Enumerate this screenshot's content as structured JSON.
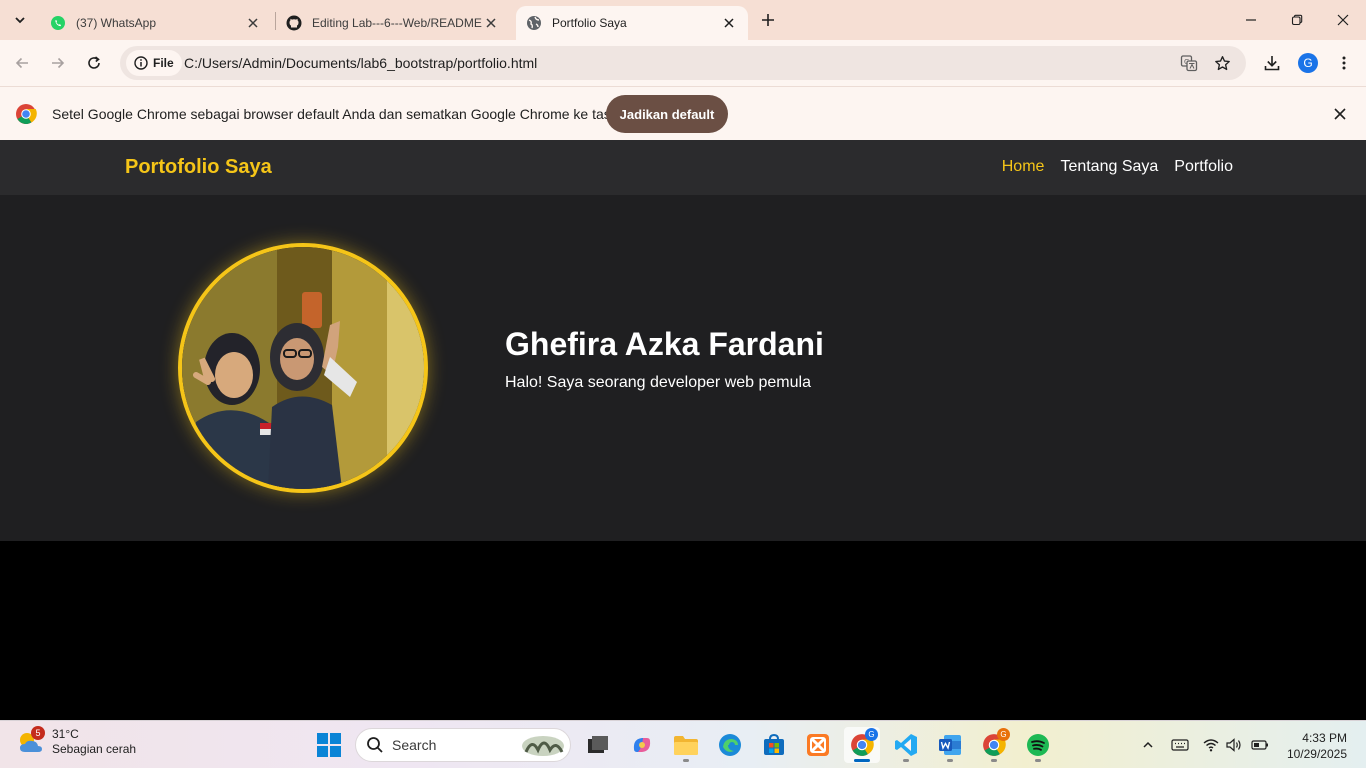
{
  "browser": {
    "tabs": [
      {
        "title": "(37) WhatsApp",
        "icon": "whatsapp-icon"
      },
      {
        "title": "Editing Lab---6---Web/README",
        "icon": "github-icon"
      },
      {
        "title": "Portfolio Saya",
        "icon": "globe-icon",
        "active": true
      }
    ],
    "address": {
      "chip_label": "File",
      "url": "C:/Users/Admin/Documents/lab6_bootstrap/portfolio.html"
    },
    "profile_initial": "G",
    "infobar": {
      "message": "Setel Google Chrome sebagai browser default Anda dan sematkan Google Chrome ke taskbar",
      "button": "Jadikan default"
    }
  },
  "site": {
    "brand": "Portofolio Saya",
    "menu": [
      "Home",
      "Tentang Saya",
      "Portfolio"
    ],
    "hero": {
      "name": "Ghefira Azka Fardani",
      "tagline": "Halo! Saya seorang developer web pemula"
    },
    "colors": {
      "accent": "#f5c518",
      "nav_bg": "#2b2b2d",
      "hero_bg": "#1f1f21"
    }
  },
  "taskbar": {
    "weather": {
      "badge": "5",
      "temp": "31°C",
      "desc": "Sebagian cerah"
    },
    "search_placeholder": "Search",
    "app_badge": "G",
    "time": "4:33 PM",
    "date": "10/29/2025"
  }
}
